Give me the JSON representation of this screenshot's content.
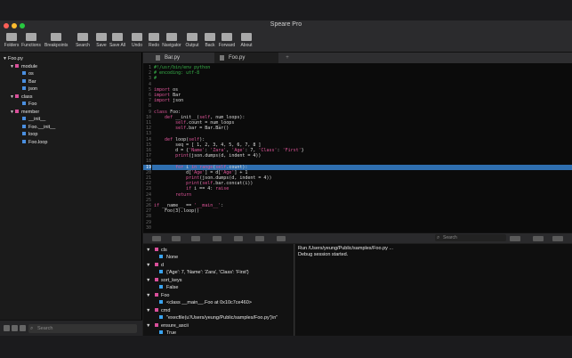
{
  "app": {
    "title": "Speare Pro"
  },
  "toolbar": {
    "items": [
      "Folders",
      "Functions",
      "Breakpoints",
      "Search",
      "Save",
      "Save All",
      "Undo",
      "Redo",
      "Navigator",
      "Output",
      "Back",
      "Forward",
      "About"
    ]
  },
  "sidebar": {
    "tree": [
      {
        "label": "Foo.py",
        "depth": 0,
        "arrow": "▼",
        "marker": ""
      },
      {
        "label": "module",
        "depth": 1,
        "arrow": "▼",
        "marker": "#d94f9a"
      },
      {
        "label": "os",
        "depth": 2,
        "arrow": "",
        "marker": "#4a8fe0"
      },
      {
        "label": "Bar",
        "depth": 2,
        "arrow": "",
        "marker": "#4a8fe0"
      },
      {
        "label": "json",
        "depth": 2,
        "arrow": "",
        "marker": "#4a8fe0"
      },
      {
        "label": "class",
        "depth": 1,
        "arrow": "▼",
        "marker": "#d94f9a"
      },
      {
        "label": "Foo",
        "depth": 2,
        "arrow": "",
        "marker": "#4a8fe0"
      },
      {
        "label": "member",
        "depth": 1,
        "arrow": "▼",
        "marker": "#d94f9a"
      },
      {
        "label": "__init__",
        "depth": 2,
        "arrow": "",
        "marker": "#4a8fe0"
      },
      {
        "label": "Foo.__init__",
        "depth": 2,
        "arrow": "",
        "marker": "#4a8fe0"
      },
      {
        "label": "loop",
        "depth": 2,
        "arrow": "",
        "marker": "#4a8fe0"
      },
      {
        "label": "Foo.loop",
        "depth": 2,
        "arrow": "",
        "marker": "#4a8fe0"
      }
    ],
    "search_placeholder": "Search"
  },
  "tabs": [
    {
      "label": "Bar.py",
      "active": false
    },
    {
      "label": "Foo.py",
      "active": true
    }
  ],
  "new_tab": "+",
  "editor": {
    "current_line": 19,
    "lines": [
      "#!/usr/bin/env python",
      "# encoding: utf-8",
      "#",
      "",
      "import os",
      "import Bar",
      "import json",
      "",
      "class Foo:",
      "    def __init__(self, num_loops):",
      "        self.count = num_loops",
      "        self.bar = Bar.Bar()",
      "",
      "    def loop(self):",
      "        seq = [ 1, 2, 3, 4, 5, 6, 7, 8 ]",
      "        d = {'Name': 'Zara', 'Age': 7, 'Class': 'First'}",
      "        print(json.dumps(d, indent = 4))",
      "",
      "        for i in range(self.count):",
      "            d['Age'] = d['Age'] + 1",
      "            print(json.dumps(d, indent = 4))",
      "            print(self.bar.concat(i))",
      "            if i == 4: raise",
      "        return",
      "",
      "if __name__ == '__main__':",
      "    Foo(3).loop()",
      "",
      "",
      ""
    ]
  },
  "debug": {
    "search_placeholder": "Search"
  },
  "variables": [
    {
      "name": "cls",
      "value": "None",
      "vcolor": "#3aa4f0"
    },
    {
      "name": "d",
      "value": "{'Age': 7, 'Name': 'Zara', 'Class': 'First'}",
      "vcolor": "#3aa4f0"
    },
    {
      "name": "sort_keys",
      "value": "False",
      "vcolor": "#3aa4f0"
    },
    {
      "name": "Foo",
      "value": "<class __main__.Foo at 0x10c7ce460>",
      "vcolor": "#3aa4f0"
    },
    {
      "name": "cmd",
      "value": "\"execfile(u'/Users/yeung/Public/samples/Foo.py')\\n\"",
      "vcolor": "#3aa4f0"
    },
    {
      "name": "ensure_ascii",
      "value": "True",
      "vcolor": "#3aa4f0"
    }
  ],
  "console": [
    "Run /Users/yeung/Public/samples/Foo.py ...",
    "Debug session started."
  ],
  "colors": {
    "keyword": "#e0559a",
    "string": "#e0559a",
    "comment": "#38b24a",
    "highlight": "#2f6fb0"
  }
}
